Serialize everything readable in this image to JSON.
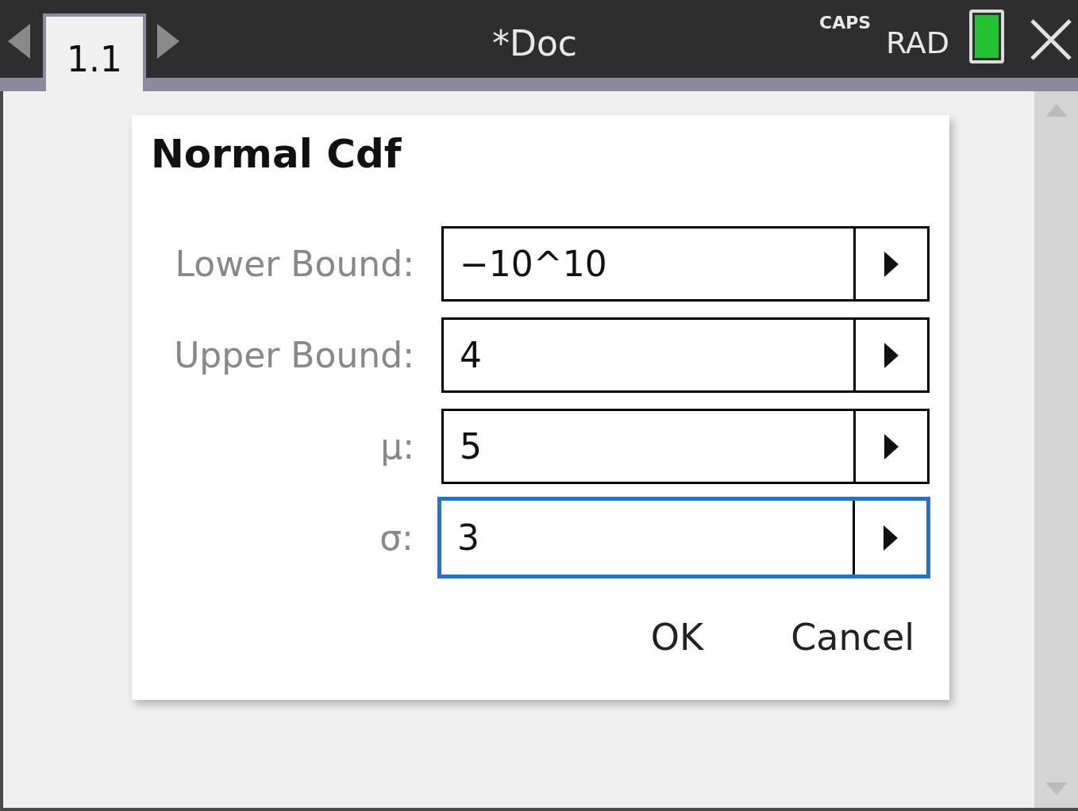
{
  "title_bar": {
    "tabs": [
      {
        "label": "1.1",
        "selected": true
      }
    ],
    "document_title": "*Doc",
    "caps": "CAPS",
    "angle_mode": "RAD"
  },
  "dialog": {
    "title": "Normal Cdf",
    "fields": [
      {
        "label": "Lower Bound:",
        "value": "−10^10",
        "focused": false
      },
      {
        "label": "Upper Bound:",
        "value": "4",
        "focused": false
      },
      {
        "label": "μ:",
        "value": "5",
        "focused": false
      },
      {
        "label": "σ:",
        "value": "3",
        "focused": true
      }
    ],
    "buttons": [
      "OK",
      "Cancel"
    ]
  }
}
